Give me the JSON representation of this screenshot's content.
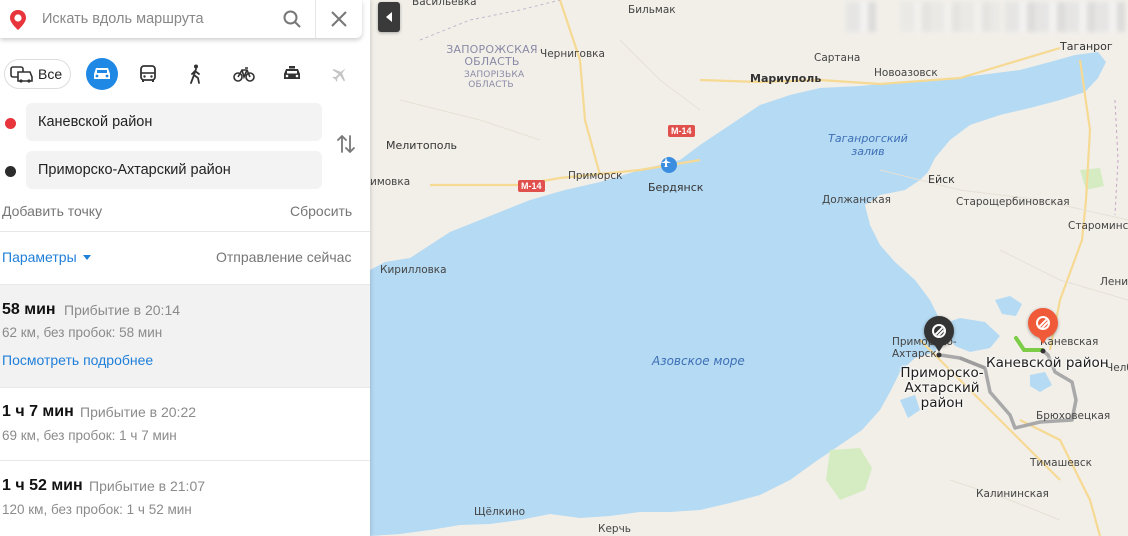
{
  "search": {
    "placeholder": "Искать вдоль маршрута"
  },
  "icons": {
    "logo": "yandex-maps-pin-logo",
    "search": "search-icon",
    "close": "close-icon",
    "collapse": "chevron-left-icon",
    "swap": "swap-arrows-icon",
    "point_a": "route-start-pin",
    "point_b": "route-end-pin"
  },
  "modes": {
    "all_label": "Все",
    "items": [
      "all",
      "car",
      "bus",
      "walk",
      "bicycle",
      "taxi",
      "plane"
    ],
    "active": "car"
  },
  "waypoints": [
    {
      "label": "Каневской район",
      "dot_color": "#e8343b"
    },
    {
      "label": "Приморско-Ахтарский район",
      "dot_color": "#2c2c2c"
    }
  ],
  "actions": {
    "add_point": "Добавить точку",
    "reset": "Сбросить"
  },
  "options": {
    "params_label": "Параметры",
    "departure_label": "Отправление сейчас"
  },
  "routes": [
    {
      "time": "58 мин",
      "arrival": "Прибытие в 20:14",
      "detail": "62 км, без пробок: 58 мин",
      "more": "Посмотреть подробнее",
      "selected": true
    },
    {
      "time": "1 ч 7 мин",
      "arrival": "Прибытие в 20:22",
      "detail": "69 км, без пробок: 1 ч 7 мин",
      "selected": false
    },
    {
      "time": "1 ч 52 мин",
      "arrival": "Прибытие в 21:07",
      "detail": "120 км, без пробок: 1 ч 52 мин",
      "selected": false
    }
  ],
  "map": {
    "colors": {
      "land": "#f2efe9",
      "water": "#b5daf3",
      "route": "#a9a9a9",
      "route_traffic": "#7ccc46",
      "road": "#f6d992"
    },
    "region_label": "ЗАПОРОЖСКАЯ ОБЛАСТЬ",
    "region_label_sub": "ЗАПОРІЗЬКА ОБЛАСТЬ",
    "water_labels": {
      "sea": "Азовское море",
      "gulf": "Таганрогский залив"
    },
    "highways": [
      "M-14",
      "M-14"
    ],
    "route_labels": {
      "start": "Приморско-Ахтарский район",
      "end": "Каневской район"
    },
    "towns": {
      "vasilevka": "Васильевка",
      "bilmak": "Бильмак",
      "chernigovka": "Черниговка",
      "sartana": "Сартана",
      "mariupol": "Мариуполь",
      "novoazovsk": "Новоазовск",
      "taganrog": "Таганрог",
      "melitopol": "Мелитополь",
      "primorsk": "Приморск",
      "berdyansk": "Бердянск",
      "yeysk": "Ейск",
      "dolzhanskaya": "Должанская",
      "staroshcherbinovskaya": "Старощербиновская",
      "starominskaya": "Староминская",
      "kirillovka": "Кирилловка",
      "lenin": "Лени",
      "primorsko_akhtarsk": "Приморско-Ахтарск",
      "kanevskaya": "Каневская",
      "chelbasskaya": "Челб",
      "bryukhovetskaya": "Брюховецкая",
      "timashevsk": "Тимашевск",
      "kalininskaya": "Калининская",
      "shchelkino": "Щёлкино",
      "kerch": "Керчь",
      "vozn": "имовка"
    }
  }
}
